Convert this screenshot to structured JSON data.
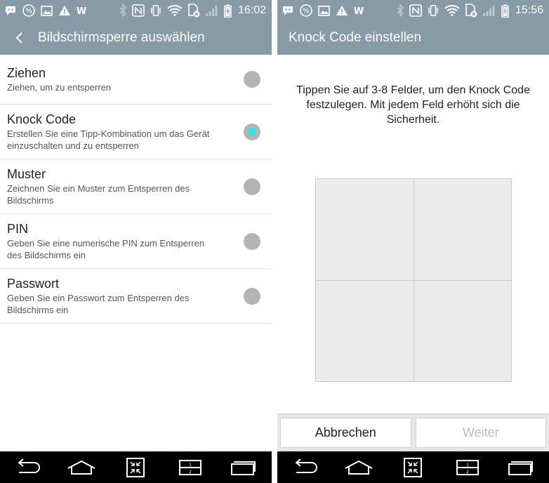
{
  "left": {
    "status_time": "16:02",
    "title": "Bildschirmsperre auswählen",
    "options": [
      {
        "title": "Ziehen",
        "subtitle": "Ziehen, um zu entsperren",
        "selected": false
      },
      {
        "title": "Knock Code",
        "subtitle": "Erstellen Sie eine Tipp-Kombination um das Gerät einzuschalten und zu entsperren",
        "selected": true
      },
      {
        "title": "Muster",
        "subtitle": "Zeichnen Sie ein Muster zum Entsperren des Bildschirms",
        "selected": false
      },
      {
        "title": "PIN",
        "subtitle": "Geben Sie eine numerische PIN zum Entsperren des Bildschirms ein",
        "selected": false
      },
      {
        "title": "Passwort",
        "subtitle": "Geben Sie ein Passwort zum Entsperren des Bildschirms ein",
        "selected": false
      }
    ]
  },
  "right": {
    "status_time": "15:56",
    "title": "Knock Code einstellen",
    "instruction": "Tippen Sie auf 3-8 Felder, um den Knock Code festzulegen. Mit jedem Feld erhöht sich die Sicherheit.",
    "cancel_label": "Abbrechen",
    "next_label": "Weiter"
  },
  "status_icons": [
    "hangouts-icon",
    "percent-icon",
    "image-icon",
    "warning-icon",
    "w-icon",
    "bluetooth-icon",
    "nfc-icon",
    "vibrate-icon",
    "wifi-icon",
    "sim-off-icon",
    "signal-icon",
    "battery-icon"
  ],
  "nav_icons": [
    "back-icon",
    "home-icon",
    "qslide-icon",
    "dual-window-icon",
    "recent-apps-icon"
  ],
  "colors": {
    "bar": "#879ba6",
    "accent": "#33e0ee",
    "radio": "#b4b4b4",
    "nav": "#000000"
  }
}
